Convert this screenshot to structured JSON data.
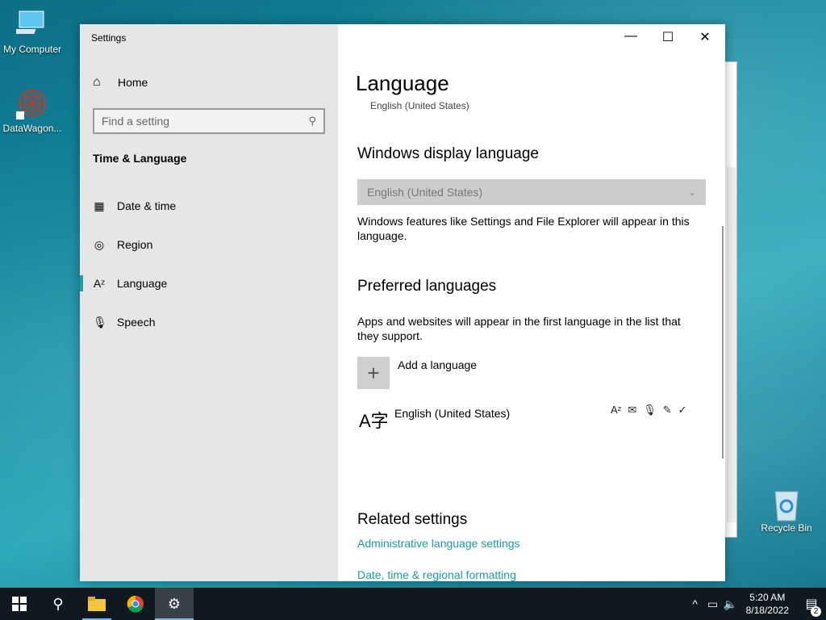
{
  "desktop": {
    "icons": [
      {
        "label": "My Computer",
        "icon": "computer-icon"
      },
      {
        "label": "DataWagon...",
        "icon": "datawagon-icon"
      },
      {
        "label": "Recycle Bin",
        "icon": "recycle-bin-icon"
      }
    ]
  },
  "window": {
    "title": "Settings",
    "controls": {
      "minimize": "—",
      "maximize": "☐",
      "close": "✕"
    }
  },
  "sidebar": {
    "home_label": "Home",
    "search_placeholder": "Find a setting",
    "section_title": "Time & Language",
    "items": [
      {
        "label": "Date & time",
        "icon": "date-time-icon",
        "active": false
      },
      {
        "label": "Region",
        "icon": "region-icon",
        "active": false
      },
      {
        "label": "Language",
        "icon": "language-icon",
        "active": true
      },
      {
        "label": "Speech",
        "icon": "microphone-icon",
        "active": false
      }
    ],
    "accent_color": "#1aa3a3"
  },
  "main": {
    "title": "Language",
    "subtitle": "English (United States)",
    "display_language": {
      "heading": "Windows display language",
      "selected": "English (United States)",
      "description": "Windows features like Settings and File Explorer will appear in this language."
    },
    "preferred": {
      "heading": "Preferred languages",
      "description": "Apps and websites will appear in the first language in the list that they support.",
      "add_label": "Add a language",
      "languages": [
        {
          "name": "English (United States)",
          "features": [
            "display-language-icon",
            "text-to-speech-icon",
            "speech-icon",
            "handwriting-icon",
            "spellcheck-icon"
          ]
        }
      ]
    },
    "related": {
      "heading": "Related settings",
      "links": [
        "Administrative language settings",
        "Date, time & regional formatting"
      ]
    },
    "link_color": "#1a9ca7"
  },
  "taskbar": {
    "time": "5:20 AM",
    "date": "8/18/2022",
    "notification_count": "2"
  }
}
